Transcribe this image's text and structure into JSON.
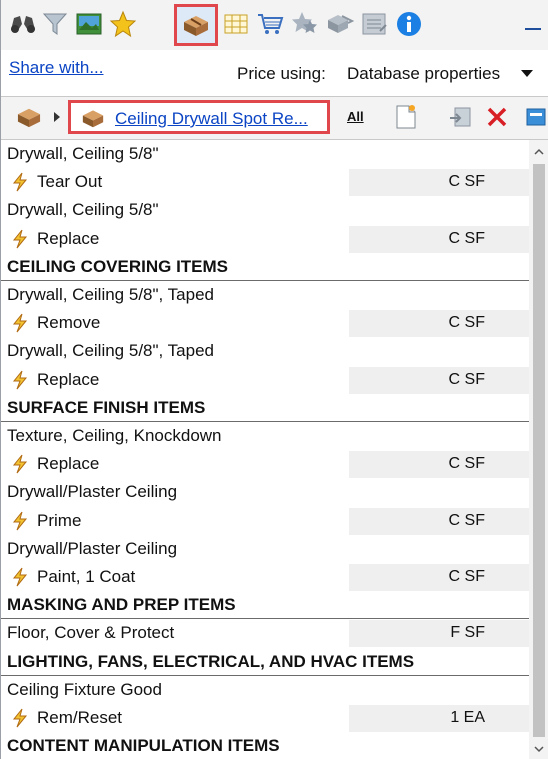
{
  "share": {
    "link_label": "Share with..."
  },
  "price": {
    "label": "Price using:",
    "value": "Database properties"
  },
  "breadcrumb": {
    "label": "Ceiling Drywall Spot Re..."
  },
  "toolbar2": {
    "all_label": "All"
  },
  "rows": [
    {
      "type": "desc",
      "text": "Drywall, Ceiling 5/8\""
    },
    {
      "type": "item",
      "text": "Tear Out",
      "qty": "C SF"
    },
    {
      "type": "desc",
      "text": "Drywall, Ceiling 5/8\""
    },
    {
      "type": "item",
      "text": "Replace",
      "qty": "C SF"
    },
    {
      "type": "section",
      "text": "CEILING COVERING ITEMS"
    },
    {
      "type": "desc",
      "text": "Drywall, Ceiling 5/8\", Taped"
    },
    {
      "type": "item",
      "text": "Remove",
      "qty": "C SF"
    },
    {
      "type": "desc",
      "text": "Drywall, Ceiling 5/8\", Taped"
    },
    {
      "type": "item",
      "text": "Replace",
      "qty": "C SF"
    },
    {
      "type": "section",
      "text": "SURFACE FINISH ITEMS"
    },
    {
      "type": "desc",
      "text": "Texture, Ceiling, Knockdown"
    },
    {
      "type": "item",
      "text": "Replace",
      "qty": "C SF"
    },
    {
      "type": "desc",
      "text": "Drywall/Plaster Ceiling"
    },
    {
      "type": "item",
      "text": "Prime",
      "qty": "C SF"
    },
    {
      "type": "desc",
      "text": "Drywall/Plaster Ceiling"
    },
    {
      "type": "item",
      "text": "Paint, 1 Coat",
      "qty": "C SF"
    },
    {
      "type": "section",
      "text": "MASKING AND PREP ITEMS"
    },
    {
      "type": "descqty",
      "text": "Floor, Cover & Protect",
      "qty": "F SF"
    },
    {
      "type": "section",
      "text": "LIGHTING, FANS, ELECTRICAL, AND HVAC ITEMS"
    },
    {
      "type": "desc",
      "text": "Ceiling Fixture Good"
    },
    {
      "type": "item",
      "text": "Rem/Reset",
      "qty": "1 EA"
    },
    {
      "type": "section",
      "text": "CONTENT MANIPULATION ITEMS"
    }
  ],
  "icons": {
    "toolbar1": [
      "binoculars-icon",
      "filter-icon",
      "picture-icon",
      "star-icon",
      "macro-box-icon",
      "table-icon",
      "cart-icon",
      "star-group-icon",
      "macro-group-icon",
      "checklist-icon",
      "info-icon"
    ],
    "toolbar2": [
      "macro-box-icon",
      "new-document-icon",
      "import-icon",
      "delete-icon",
      "export-icon"
    ]
  },
  "colors": {
    "selection_outline": "#e0474c",
    "link": "#0b44c4",
    "toolbar_bg": "#f3f3f3",
    "qty_cell_bg": "#efefef"
  }
}
